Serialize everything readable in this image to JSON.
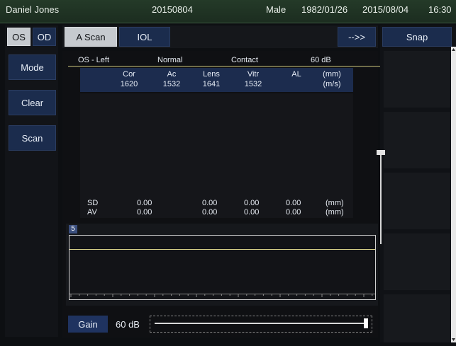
{
  "topbar": {
    "patient_name": "Daniel Jones",
    "exam_id": "20150804",
    "sex": "Male",
    "dob": "1982/01/26",
    "date": "2015/08/04",
    "time": "16:30"
  },
  "eye_toggle": {
    "os_label": "OS",
    "od_label": "OD",
    "selected": "OS"
  },
  "left_buttons": {
    "mode": "Mode",
    "clear": "Clear",
    "scan": "Scan"
  },
  "tabs": {
    "ascan": "A Scan",
    "iol": "IOL",
    "next": "-->>",
    "active": "A Scan"
  },
  "snap_label": "Snap",
  "info_row": {
    "eye": "OS - Left",
    "mode": "Normal",
    "probe": "Contact",
    "gain": "60  dB"
  },
  "velocities": {
    "headers": [
      "Cor",
      "Ac",
      "Lens",
      "Vitr",
      "AL",
      "(mm)"
    ],
    "values": [
      "1620",
      "1532",
      "1641",
      "1532",
      "",
      "(m/s)"
    ]
  },
  "stats": {
    "sd": {
      "label": "SD",
      "values": [
        "0.00",
        "0.00",
        "0.00",
        "0.00"
      ],
      "unit": "(mm)"
    },
    "av": {
      "label": "AV",
      "values": [
        "0.00",
        "0.00",
        "0.00",
        "0.00"
      ],
      "unit": "(mm)"
    }
  },
  "bscan_index": "5",
  "gain_control": {
    "label": "Gain",
    "value": "60  dB",
    "level_fraction": 1.0
  }
}
